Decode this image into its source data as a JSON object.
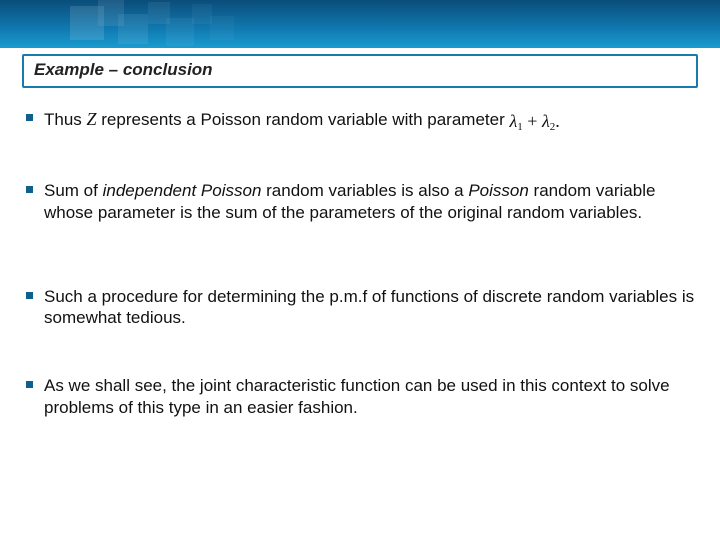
{
  "slide": {
    "title": "Example – conclusion",
    "bullets": [
      {
        "pre": "Thus ",
        "var": "Z",
        "mid": " represents a Poisson random variable with  parameter  ",
        "lambda1": "λ",
        "sub1": "1",
        "plus": " + ",
        "lambda2": "λ",
        "sub2": "2",
        "end": "."
      },
      {
        "pre": "Sum of ",
        "em1": "independent",
        "mid1": " ",
        "em2": "Poisson",
        "mid2": " random variables is also a ",
        "em3": "Poisson",
        "post": " random variable whose parameter is the sum of the parameters of the original random variables."
      },
      {
        "text": "Such a procedure for determining the p.m.f of functions of discrete random variables is somewhat tedious."
      },
      {
        "text": "As we shall see, the joint characteristic function can be used in this context to solve problems of this type in an easier fashion."
      }
    ]
  }
}
